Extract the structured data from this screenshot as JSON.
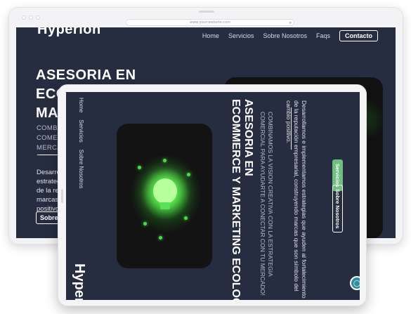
{
  "back": {
    "url": "www.your-website.com",
    "logo": "Hyperion",
    "nav": [
      "Home",
      "Servicios",
      "Sobre Nosotros",
      "Faqs"
    ],
    "cta": "Contacto",
    "heading": [
      "ASESORIA EN",
      "ECOMMERCE Y",
      "MAR"
    ],
    "tagline": [
      "COMBINA",
      "COMERCI",
      "MERCADO"
    ],
    "paragraph": [
      "Desarrollar",
      "estrategia",
      "de la repub",
      "marcas qu",
      "positivo."
    ],
    "button": "Sobre Nos"
  },
  "front": {
    "logo": "Hyperion",
    "nav": [
      "Home",
      "Servicios",
      "Sobre Nosotros"
    ],
    "heading": [
      "ASESORIA EN",
      "ECOMMERCE Y MARKETING ECOLOGICO"
    ],
    "tagline": [
      "COMBINAMOS LA VISION CREATIVA CON LA ESTRATEGIA",
      "COMERCIAL PARA AYUDARTE A CONECTAR CON TU MERCADO!"
    ],
    "paragraph": [
      "Desarrollamos e implementamos estrategias que ayuden al fortalecimiento",
      "de la reputación empresarial, construyendo marcas que son símbolo del",
      "cambio positivo."
    ],
    "btn_sobre": "Sobre Nosotros",
    "btn_servicios": "Servicios"
  },
  "colors": {
    "dark_navy": "#272d40",
    "accent_green": "#6fbf80",
    "teal": "#2f8f9f"
  }
}
